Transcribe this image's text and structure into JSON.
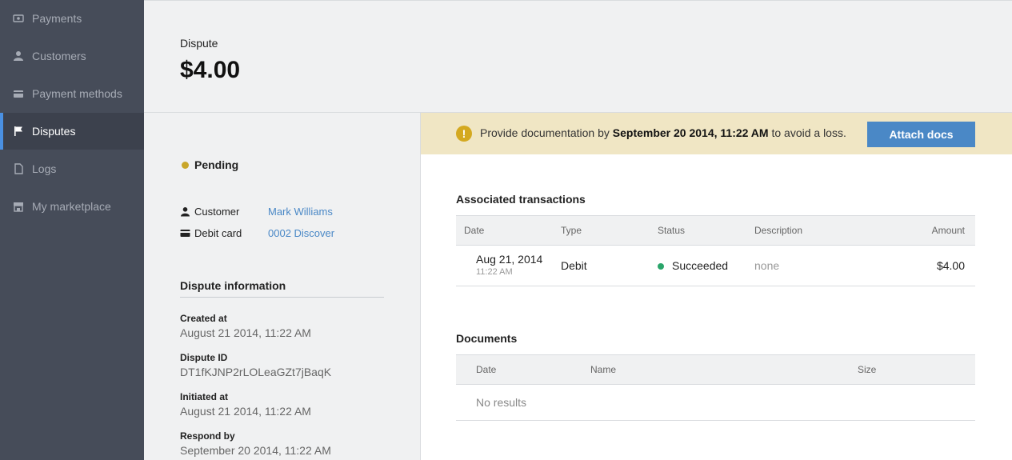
{
  "sidebar": {
    "items": [
      {
        "label": "Payments",
        "icon": "payments-icon"
      },
      {
        "label": "Customers",
        "icon": "customer-icon"
      },
      {
        "label": "Payment methods",
        "icon": "card-icon"
      },
      {
        "label": "Disputes",
        "icon": "flag-icon",
        "active": true
      },
      {
        "label": "Logs",
        "icon": "logs-icon"
      },
      {
        "label": "My marketplace",
        "icon": "marketplace-icon"
      }
    ]
  },
  "header": {
    "label": "Dispute",
    "amount": "$4.00"
  },
  "details": {
    "status": "Pending",
    "customer_label": "Customer",
    "customer_name": "Mark Williams",
    "card_label": "Debit card",
    "card_value": "0002 Discover",
    "section_title": "Dispute information",
    "fields": [
      {
        "label": "Created at",
        "value": "August 21 2014, 11:22 AM"
      },
      {
        "label": "Dispute ID",
        "value": "DT1fKJNP2rLOLeaGZt7jBaqK"
      },
      {
        "label": "Initiated at",
        "value": "August 21 2014, 11:22 AM"
      },
      {
        "label": "Respond by",
        "value": "September 20 2014, 11:22 AM"
      }
    ]
  },
  "banner": {
    "prefix": "Provide documentation by ",
    "deadline": "September 20 2014, 11:22 AM",
    "suffix": " to avoid a loss.",
    "button": "Attach docs"
  },
  "transactions": {
    "title": "Associated transactions",
    "columns": [
      "Date",
      "Type",
      "Status",
      "Description",
      "Amount"
    ],
    "rows": [
      {
        "date": "Aug 21, 2014",
        "time": "11:22 AM",
        "type": "Debit",
        "status": "Succeeded",
        "description": "none",
        "amount": "$4.00"
      }
    ]
  },
  "documents": {
    "title": "Documents",
    "columns": [
      "Date",
      "Name",
      "Size"
    ],
    "empty": "No results"
  },
  "colors": {
    "sidebar_bg": "#464c59",
    "accent": "#4a88c6",
    "pending": "#c9a62a",
    "success": "#2aa56a",
    "banner_bg": "#f0e6c4"
  }
}
